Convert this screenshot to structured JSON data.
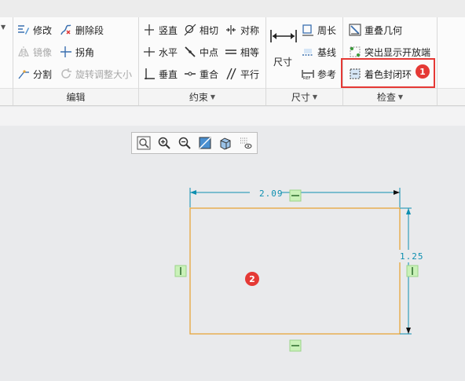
{
  "ribbon": {
    "edit": {
      "modify": "修改",
      "delete_segment": "删除段",
      "mirror": "镜像",
      "corner": "拐角",
      "divide": "分割",
      "rotate_resize": "旋转调整大小",
      "group_label": "编辑"
    },
    "constrain": {
      "vertical": "竖直",
      "tangent": "相切",
      "symmetric": "对称",
      "horizontal": "水平",
      "midpoint": "中点",
      "equal": "相等",
      "perpendicular": "垂直",
      "coincident": "重合",
      "parallel": "平行",
      "group_label": "约束"
    },
    "dimension": {
      "dimension": "尺寸",
      "perimeter": "周长",
      "baseline": "基线",
      "reference": "参考",
      "group_label": "尺寸"
    },
    "inspect": {
      "overlapping_geometry": "重叠几何",
      "highlight_open_ends": "突出显示开放端",
      "shade_closed_loops": "着色封闭环",
      "group_label": "检查"
    }
  },
  "annotations": {
    "badge_1": "1",
    "badge_2": "2"
  },
  "sketch": {
    "width_dim": "2.09",
    "height_dim": "1.25",
    "colors": {
      "rectangle": "#e8a53a",
      "dimension": "#0d8fb0",
      "constraint_bg": "#c9f1b8",
      "highlight": "#e53935"
    }
  }
}
